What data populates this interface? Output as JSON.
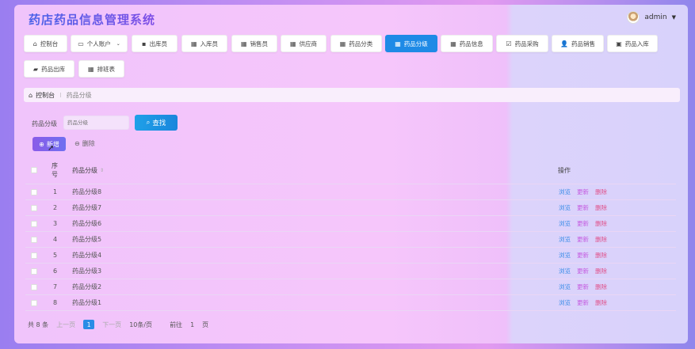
{
  "app": {
    "title": "药店药品信息管理系统"
  },
  "user": {
    "name": "admin"
  },
  "nav": [
    {
      "label": "控制台",
      "icon": "home-icon",
      "glyph": "⌂",
      "active": false
    },
    {
      "label": "个人账户",
      "icon": "user-card-icon",
      "glyph": "▭",
      "active": false,
      "dropdown": true
    },
    {
      "label": "出库员",
      "icon": "monitor-icon",
      "glyph": "▪",
      "active": false
    },
    {
      "label": "入库员",
      "icon": "grid-icon",
      "glyph": "▦",
      "active": false
    },
    {
      "label": "销售员",
      "icon": "grid-icon",
      "glyph": "▦",
      "active": false
    },
    {
      "label": "供应商",
      "icon": "grid-icon",
      "glyph": "▦",
      "active": false
    },
    {
      "label": "药品分类",
      "icon": "grid-icon",
      "glyph": "▦",
      "active": false
    },
    {
      "label": "药品分级",
      "icon": "grid-icon",
      "glyph": "▦",
      "active": true
    },
    {
      "label": "药品信息",
      "icon": "grid-icon",
      "glyph": "▦",
      "active": false
    },
    {
      "label": "药品采购",
      "icon": "checkbox-icon",
      "glyph": "☑",
      "active": false
    },
    {
      "label": "药品销售",
      "icon": "person-icon",
      "glyph": "👤",
      "active": false
    },
    {
      "label": "药品入库",
      "icon": "briefcase-icon",
      "glyph": "▣",
      "active": false
    },
    {
      "label": "药品出库",
      "icon": "truck-icon",
      "glyph": "▰",
      "active": false
    },
    {
      "label": "排班表",
      "icon": "grid-icon",
      "glyph": "▦",
      "active": false
    }
  ],
  "breadcrumb": {
    "home": "控制台",
    "separator": "⁝",
    "current": "药品分级"
  },
  "search": {
    "label": "药品分级",
    "placeholder": "药品分级",
    "button": "查找"
  },
  "actions": {
    "add": "新增",
    "delete": "删除"
  },
  "table": {
    "headers": {
      "index": "序号",
      "name": "药品分级",
      "ops": "操作"
    },
    "rows": [
      {
        "index": "1",
        "name": "药品分级8"
      },
      {
        "index": "2",
        "name": "药品分级7"
      },
      {
        "index": "3",
        "name": "药品分级6"
      },
      {
        "index": "4",
        "name": "药品分级5"
      },
      {
        "index": "5",
        "name": "药品分级4"
      },
      {
        "index": "6",
        "name": "药品分级3"
      },
      {
        "index": "7",
        "name": "药品分级2"
      },
      {
        "index": "8",
        "name": "药品分级1"
      }
    ],
    "row_actions": {
      "view": "浏览",
      "update": "更新",
      "delete": "删除"
    }
  },
  "pager": {
    "total": "共 8 条",
    "prev": "上一页",
    "page": "1",
    "next": "下一页",
    "page_size": "10条/页",
    "goto_label": "前往",
    "goto_value": "1",
    "goto_unit": "页"
  },
  "colors": {
    "accent": "#1e8ae6",
    "add": "#7b63ec",
    "view": "#3b8de8",
    "update": "#c45be0",
    "delete": "#e0508a"
  }
}
